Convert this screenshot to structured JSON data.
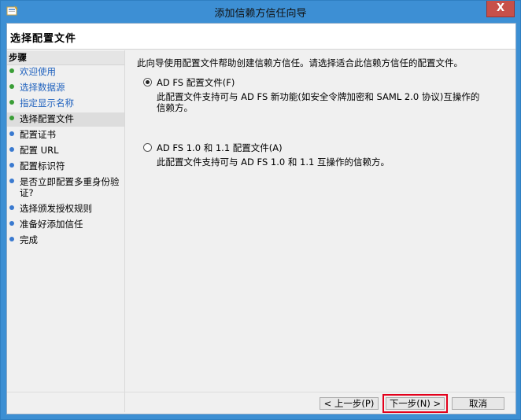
{
  "window": {
    "title": "添加信赖方信任向导",
    "close_glyph": "X"
  },
  "header": {
    "page_title": "选择配置文件"
  },
  "steps": {
    "heading": "步骤",
    "items": [
      {
        "label": "欢迎使用",
        "state": "done"
      },
      {
        "label": "选择数据源",
        "state": "done"
      },
      {
        "label": "指定显示名称",
        "state": "done"
      },
      {
        "label": "选择配置文件",
        "state": "current"
      },
      {
        "label": "配置证书",
        "state": "todo"
      },
      {
        "label": "配置 URL",
        "state": "todo"
      },
      {
        "label": "配置标识符",
        "state": "todo"
      },
      {
        "label": "是否立即配置多重身份验证?",
        "state": "todo"
      },
      {
        "label": "选择颁发授权规则",
        "state": "todo"
      },
      {
        "label": "准备好添加信任",
        "state": "todo"
      },
      {
        "label": "完成",
        "state": "todo"
      }
    ]
  },
  "content": {
    "intro": "此向导使用配置文件帮助创建信赖方信任。请选择适合此信赖方信任的配置文件。",
    "options": [
      {
        "label": "AD FS 配置文件(F)",
        "selected": true,
        "description": "此配置文件支持可与 AD FS 新功能(如安全令牌加密和 SAML 2.0 协议)互操作的信赖方。"
      },
      {
        "label": "AD FS 1.0 和 1.1 配置文件(A)",
        "selected": false,
        "description": "此配置文件支持可与 AD FS 1.0 和 1.1 互操作的信赖方。"
      }
    ]
  },
  "buttons": {
    "prev": "< 上一步(P)",
    "next": "下一步(N) >",
    "cancel": "取消"
  },
  "colors": {
    "titlebar": "#3d8fd4",
    "step_done": "#3a9e37",
    "step_todo": "#3a7ad0",
    "link": "#2364bf",
    "highlight": "#e3001b"
  }
}
